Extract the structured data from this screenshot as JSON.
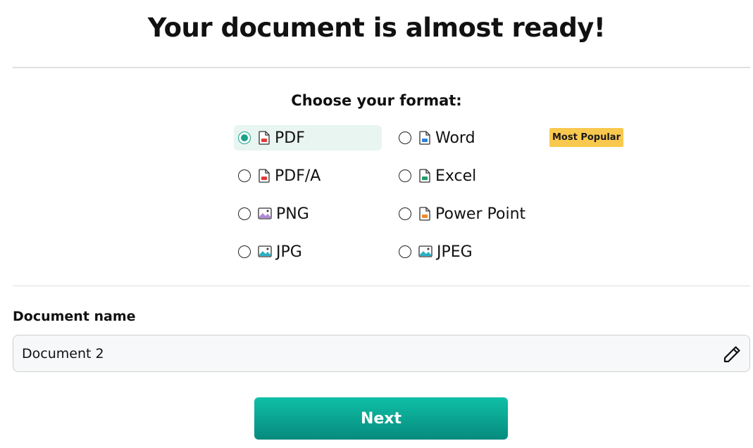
{
  "page": {
    "title": "Your document is almost ready!",
    "format_heading": "Choose your format:",
    "badge": "Most Popular",
    "accent_color": "#1aa38a",
    "badge_color": "#f9c94f"
  },
  "formats": [
    {
      "label": "PDF",
      "icon": "pdf-file-icon",
      "selected": true
    },
    {
      "label": "Word",
      "icon": "word-file-icon",
      "selected": false
    },
    {
      "label": "PDF/A",
      "icon": "pdfa-file-icon",
      "selected": false
    },
    {
      "label": "Excel",
      "icon": "excel-file-icon",
      "selected": false
    },
    {
      "label": "PNG",
      "icon": "png-image-icon",
      "selected": false
    },
    {
      "label": "Power Point",
      "icon": "powerpoint-file-icon",
      "selected": false
    },
    {
      "label": "JPG",
      "icon": "jpg-image-icon",
      "selected": false
    },
    {
      "label": "JPEG",
      "icon": "jpeg-image-icon",
      "selected": false
    }
  ],
  "document": {
    "label": "Document name",
    "value": "Document 2"
  },
  "actions": {
    "next_label": "Next"
  }
}
